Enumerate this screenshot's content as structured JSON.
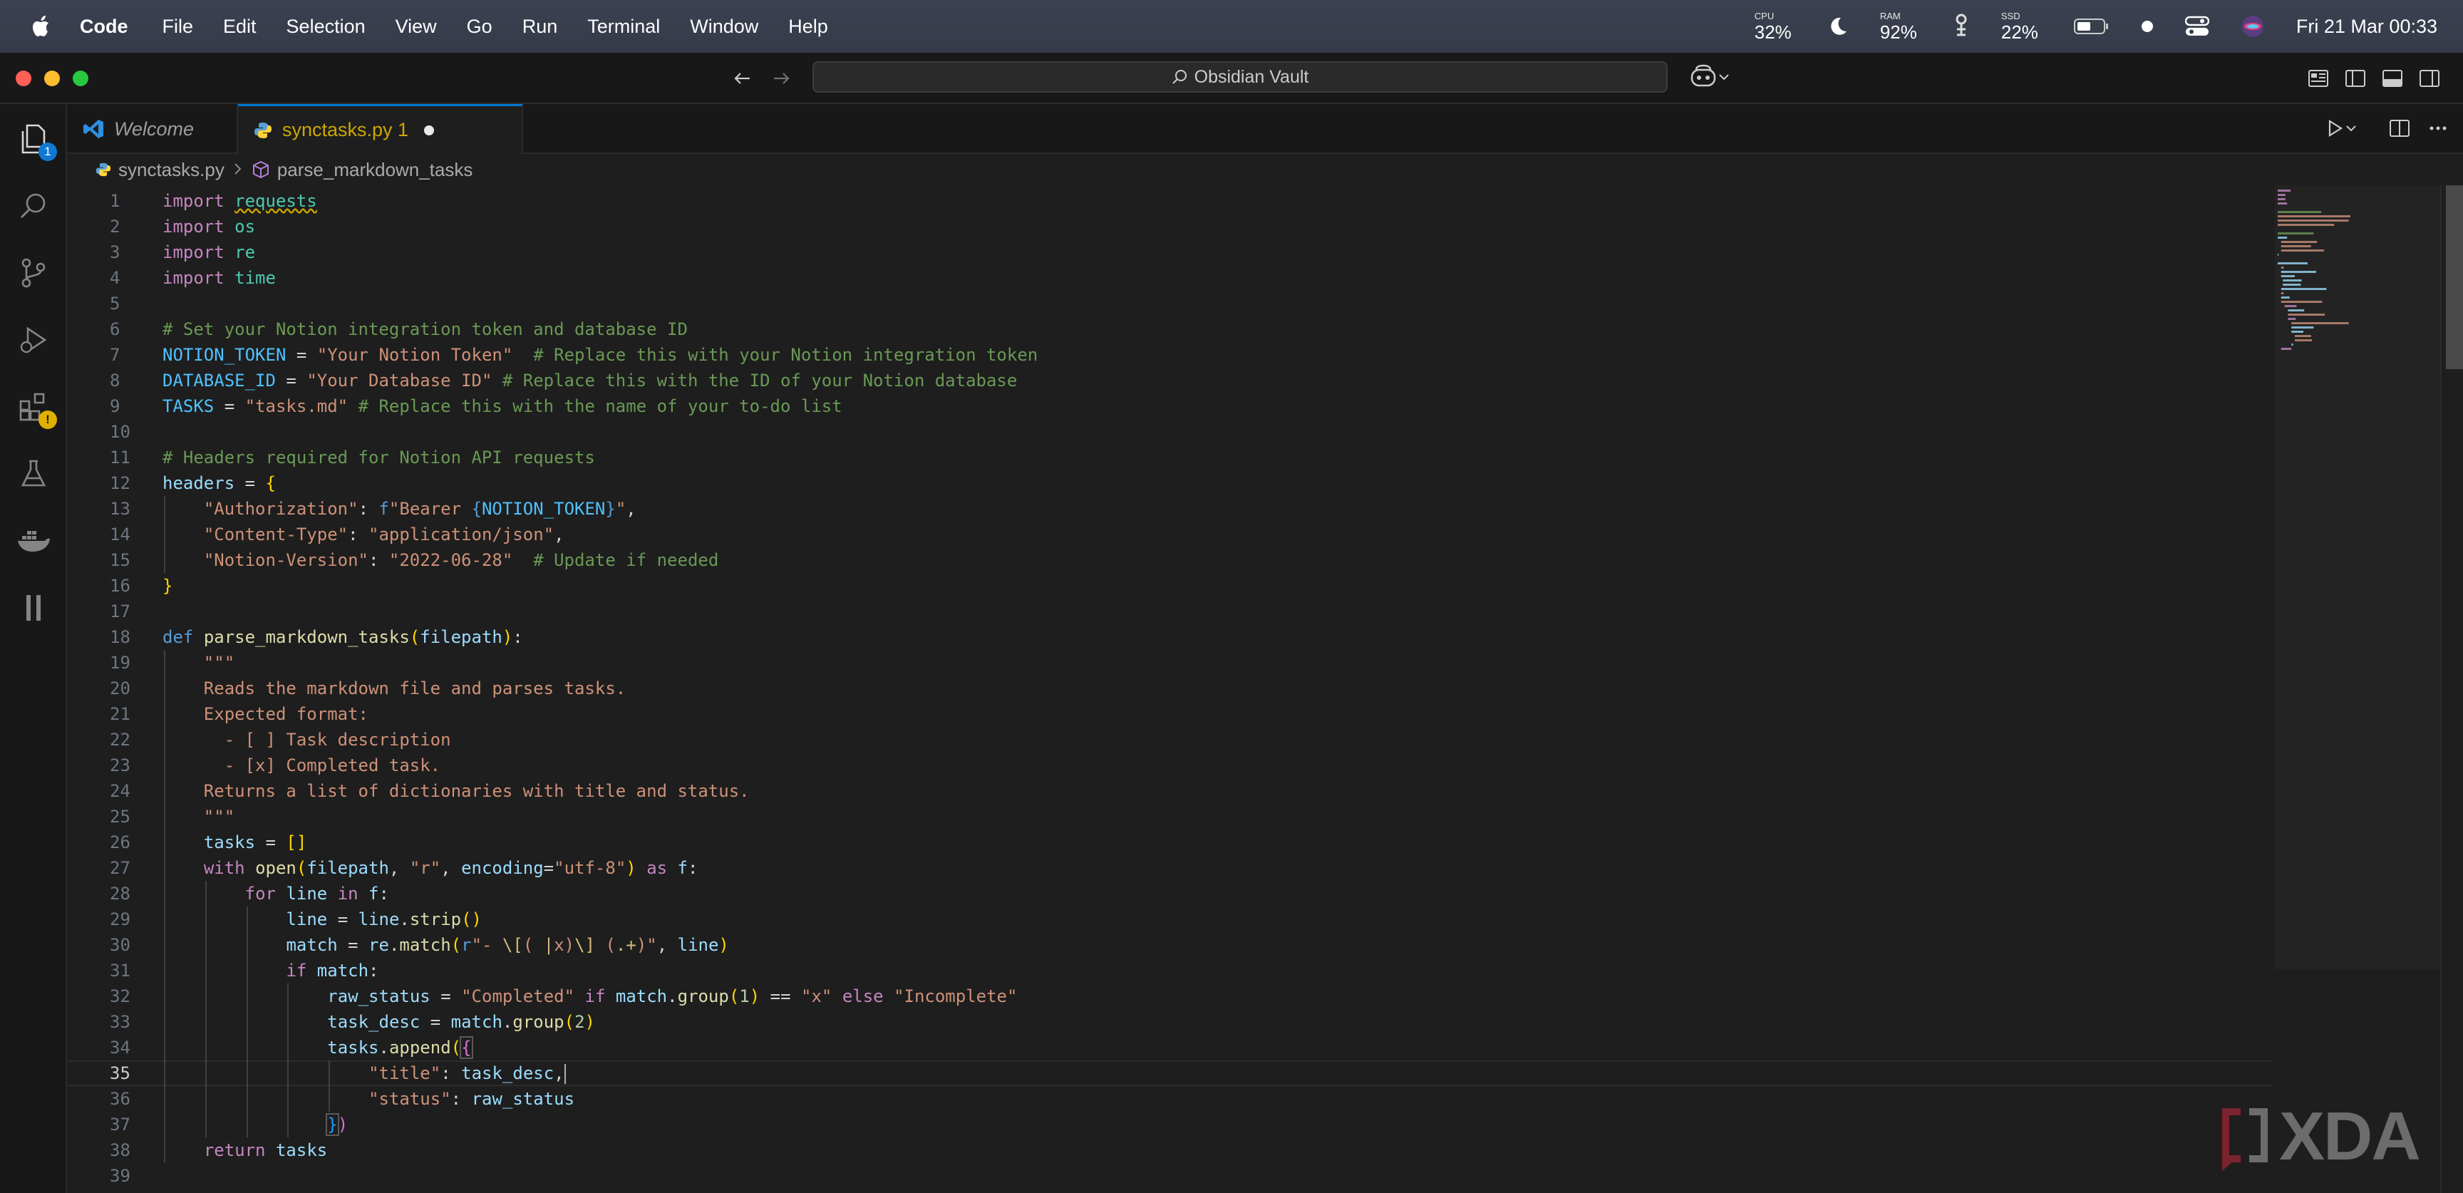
{
  "menubar": {
    "app_name": "Code",
    "items": [
      "File",
      "Edit",
      "Selection",
      "View",
      "Go",
      "Run",
      "Terminal",
      "Window",
      "Help"
    ],
    "cpu_label": "CPU",
    "cpu_value": "32%",
    "ram_label": "RAM",
    "ram_value": "92%",
    "ssd_label": "SSD",
    "ssd_value": "22%",
    "clock": "Fri 21 Mar  00:33"
  },
  "titlebar": {
    "command_center": "Obsidian Vault"
  },
  "activitybar": {
    "explorer_badge": "1",
    "extensions_badge": "!"
  },
  "tabs": [
    {
      "label": "Welcome"
    },
    {
      "label": "synctasks.py 1"
    }
  ],
  "breadcrumb": {
    "file": "synctasks.py",
    "symbol": "parse_markdown_tasks"
  },
  "editor": {
    "active_line": 35,
    "lines": [
      {
        "n": "1",
        "t": "import requests"
      },
      {
        "n": "2",
        "t": "import os"
      },
      {
        "n": "3",
        "t": "import re"
      },
      {
        "n": "4",
        "t": "import time"
      },
      {
        "n": "5",
        "t": ""
      },
      {
        "n": "6",
        "t": "# Set your Notion integration token and database ID"
      },
      {
        "n": "7",
        "t": "NOTION_TOKEN = \"Your Notion Token\"  # Replace this with your Notion integration token"
      },
      {
        "n": "8",
        "t": "DATABASE_ID = \"Your Database ID\" # Replace this with the ID of your Notion database"
      },
      {
        "n": "9",
        "t": "TASKS = \"tasks.md\" # Replace this with the name of your to-do list"
      },
      {
        "n": "10",
        "t": ""
      },
      {
        "n": "11",
        "t": "# Headers required for Notion API requests"
      },
      {
        "n": "12",
        "t": "headers = {"
      },
      {
        "n": "13",
        "t": "    \"Authorization\": f\"Bearer {NOTION_TOKEN}\","
      },
      {
        "n": "14",
        "t": "    \"Content-Type\": \"application/json\","
      },
      {
        "n": "15",
        "t": "    \"Notion-Version\": \"2022-06-28\"  # Update if needed"
      },
      {
        "n": "16",
        "t": "}"
      },
      {
        "n": "17",
        "t": ""
      },
      {
        "n": "18",
        "t": "def parse_markdown_tasks(filepath):"
      },
      {
        "n": "19",
        "t": "    \"\"\""
      },
      {
        "n": "20",
        "t": "    Reads the markdown file and parses tasks."
      },
      {
        "n": "21",
        "t": "    Expected format:"
      },
      {
        "n": "22",
        "t": "      - [ ] Task description"
      },
      {
        "n": "23",
        "t": "      - [x] Completed task."
      },
      {
        "n": "24",
        "t": "    Returns a list of dictionaries with title and status."
      },
      {
        "n": "25",
        "t": "    \"\"\""
      },
      {
        "n": "26",
        "t": "    tasks = []"
      },
      {
        "n": "27",
        "t": "    with open(filepath, \"r\", encoding=\"utf-8\") as f:"
      },
      {
        "n": "28",
        "t": "        for line in f:"
      },
      {
        "n": "29",
        "t": "            line = line.strip()"
      },
      {
        "n": "30",
        "t": "            match = re.match(r\"- \\[( |x)\\] (.+)\", line)"
      },
      {
        "n": "31",
        "t": "            if match:"
      },
      {
        "n": "32",
        "t": "                raw_status = \"Completed\" if match.group(1) == \"x\" else \"Incomplete\""
      },
      {
        "n": "33",
        "t": "                task_desc = match.group(2)"
      },
      {
        "n": "34",
        "t": "                tasks.append({"
      },
      {
        "n": "35",
        "t": "                    \"title\": task_desc,"
      },
      {
        "n": "36",
        "t": "                    \"status\": raw_status"
      },
      {
        "n": "37",
        "t": "                })"
      },
      {
        "n": "38",
        "t": "    return tasks"
      },
      {
        "n": "39",
        "t": ""
      }
    ]
  },
  "watermark": {
    "text": "XDA"
  },
  "colors": {
    "accent": "#0078d4",
    "modified_tab": "#cca700",
    "keyword": "#c586c0",
    "string": "#ce9178",
    "comment": "#6a9955"
  }
}
